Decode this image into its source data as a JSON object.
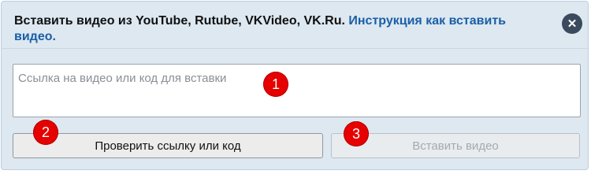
{
  "header": {
    "title": "Вставить видео из YouTube, Rutube, VKVideo, VK.Ru.",
    "instruction_link": "Инструкция как вставить видео."
  },
  "close_icon": "close-icon",
  "input": {
    "placeholder": "Ссылка на видео или код для вставки",
    "value": ""
  },
  "buttons": {
    "check_label": "Проверить ссылку или код",
    "insert_label": "Вставить видео",
    "insert_disabled": true
  },
  "badges": [
    "1",
    "2",
    "3"
  ],
  "colors": {
    "dialog_bg": "#dde8f1",
    "link": "#1a5fa6",
    "close_button": "#3c4a5e",
    "badge": "#e60000"
  }
}
